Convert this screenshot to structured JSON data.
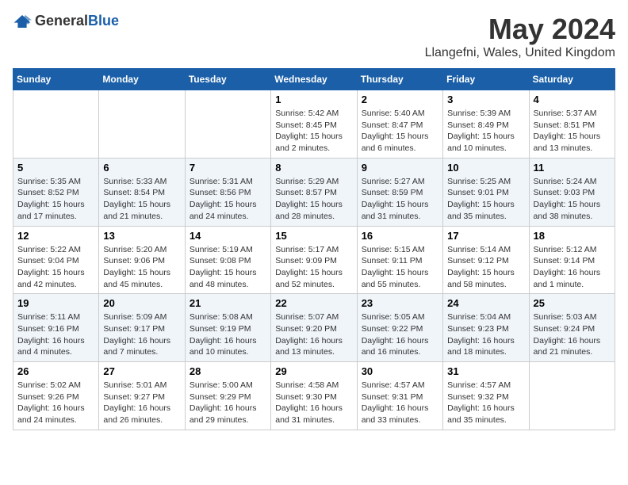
{
  "logo": {
    "general": "General",
    "blue": "Blue"
  },
  "title": "May 2024",
  "location": "Llangefni, Wales, United Kingdom",
  "days_of_week": [
    "Sunday",
    "Monday",
    "Tuesday",
    "Wednesday",
    "Thursday",
    "Friday",
    "Saturday"
  ],
  "weeks": [
    [
      {
        "day": "",
        "info": ""
      },
      {
        "day": "",
        "info": ""
      },
      {
        "day": "",
        "info": ""
      },
      {
        "day": "1",
        "info": "Sunrise: 5:42 AM\nSunset: 8:45 PM\nDaylight: 15 hours\nand 2 minutes."
      },
      {
        "day": "2",
        "info": "Sunrise: 5:40 AM\nSunset: 8:47 PM\nDaylight: 15 hours\nand 6 minutes."
      },
      {
        "day": "3",
        "info": "Sunrise: 5:39 AM\nSunset: 8:49 PM\nDaylight: 15 hours\nand 10 minutes."
      },
      {
        "day": "4",
        "info": "Sunrise: 5:37 AM\nSunset: 8:51 PM\nDaylight: 15 hours\nand 13 minutes."
      }
    ],
    [
      {
        "day": "5",
        "info": "Sunrise: 5:35 AM\nSunset: 8:52 PM\nDaylight: 15 hours\nand 17 minutes."
      },
      {
        "day": "6",
        "info": "Sunrise: 5:33 AM\nSunset: 8:54 PM\nDaylight: 15 hours\nand 21 minutes."
      },
      {
        "day": "7",
        "info": "Sunrise: 5:31 AM\nSunset: 8:56 PM\nDaylight: 15 hours\nand 24 minutes."
      },
      {
        "day": "8",
        "info": "Sunrise: 5:29 AM\nSunset: 8:57 PM\nDaylight: 15 hours\nand 28 minutes."
      },
      {
        "day": "9",
        "info": "Sunrise: 5:27 AM\nSunset: 8:59 PM\nDaylight: 15 hours\nand 31 minutes."
      },
      {
        "day": "10",
        "info": "Sunrise: 5:25 AM\nSunset: 9:01 PM\nDaylight: 15 hours\nand 35 minutes."
      },
      {
        "day": "11",
        "info": "Sunrise: 5:24 AM\nSunset: 9:03 PM\nDaylight: 15 hours\nand 38 minutes."
      }
    ],
    [
      {
        "day": "12",
        "info": "Sunrise: 5:22 AM\nSunset: 9:04 PM\nDaylight: 15 hours\nand 42 minutes."
      },
      {
        "day": "13",
        "info": "Sunrise: 5:20 AM\nSunset: 9:06 PM\nDaylight: 15 hours\nand 45 minutes."
      },
      {
        "day": "14",
        "info": "Sunrise: 5:19 AM\nSunset: 9:08 PM\nDaylight: 15 hours\nand 48 minutes."
      },
      {
        "day": "15",
        "info": "Sunrise: 5:17 AM\nSunset: 9:09 PM\nDaylight: 15 hours\nand 52 minutes."
      },
      {
        "day": "16",
        "info": "Sunrise: 5:15 AM\nSunset: 9:11 PM\nDaylight: 15 hours\nand 55 minutes."
      },
      {
        "day": "17",
        "info": "Sunrise: 5:14 AM\nSunset: 9:12 PM\nDaylight: 15 hours\nand 58 minutes."
      },
      {
        "day": "18",
        "info": "Sunrise: 5:12 AM\nSunset: 9:14 PM\nDaylight: 16 hours\nand 1 minute."
      }
    ],
    [
      {
        "day": "19",
        "info": "Sunrise: 5:11 AM\nSunset: 9:16 PM\nDaylight: 16 hours\nand 4 minutes."
      },
      {
        "day": "20",
        "info": "Sunrise: 5:09 AM\nSunset: 9:17 PM\nDaylight: 16 hours\nand 7 minutes."
      },
      {
        "day": "21",
        "info": "Sunrise: 5:08 AM\nSunset: 9:19 PM\nDaylight: 16 hours\nand 10 minutes."
      },
      {
        "day": "22",
        "info": "Sunrise: 5:07 AM\nSunset: 9:20 PM\nDaylight: 16 hours\nand 13 minutes."
      },
      {
        "day": "23",
        "info": "Sunrise: 5:05 AM\nSunset: 9:22 PM\nDaylight: 16 hours\nand 16 minutes."
      },
      {
        "day": "24",
        "info": "Sunrise: 5:04 AM\nSunset: 9:23 PM\nDaylight: 16 hours\nand 18 minutes."
      },
      {
        "day": "25",
        "info": "Sunrise: 5:03 AM\nSunset: 9:24 PM\nDaylight: 16 hours\nand 21 minutes."
      }
    ],
    [
      {
        "day": "26",
        "info": "Sunrise: 5:02 AM\nSunset: 9:26 PM\nDaylight: 16 hours\nand 24 minutes."
      },
      {
        "day": "27",
        "info": "Sunrise: 5:01 AM\nSunset: 9:27 PM\nDaylight: 16 hours\nand 26 minutes."
      },
      {
        "day": "28",
        "info": "Sunrise: 5:00 AM\nSunset: 9:29 PM\nDaylight: 16 hours\nand 29 minutes."
      },
      {
        "day": "29",
        "info": "Sunrise: 4:58 AM\nSunset: 9:30 PM\nDaylight: 16 hours\nand 31 minutes."
      },
      {
        "day": "30",
        "info": "Sunrise: 4:57 AM\nSunset: 9:31 PM\nDaylight: 16 hours\nand 33 minutes."
      },
      {
        "day": "31",
        "info": "Sunrise: 4:57 AM\nSunset: 9:32 PM\nDaylight: 16 hours\nand 35 minutes."
      },
      {
        "day": "",
        "info": ""
      }
    ]
  ]
}
